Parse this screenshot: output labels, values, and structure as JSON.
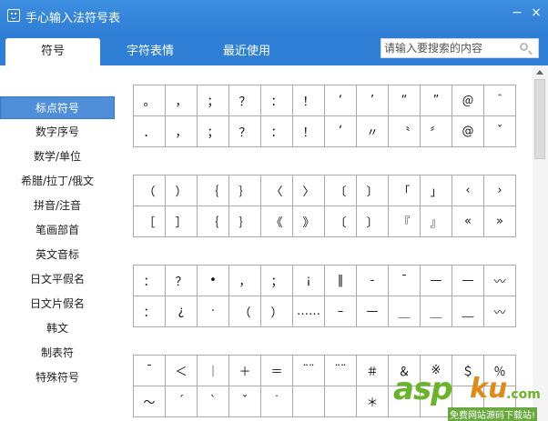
{
  "window": {
    "title": "手心输入法符号表",
    "minimize_label": "−",
    "close_label": "×"
  },
  "tabs": [
    {
      "label": "符号",
      "active": true
    },
    {
      "label": "字符表情",
      "active": false
    },
    {
      "label": "最近使用",
      "active": false
    }
  ],
  "search": {
    "placeholder": "请输入要搜索的内容"
  },
  "sidebar": {
    "items": [
      {
        "label": "标点符号",
        "active": true
      },
      {
        "label": "数字序号"
      },
      {
        "label": "数学/单位"
      },
      {
        "label": "希腊/拉丁/俄文"
      },
      {
        "label": "拼音/注音"
      },
      {
        "label": "笔画部首"
      },
      {
        "label": "英文音标"
      },
      {
        "label": "日文平假名"
      },
      {
        "label": "日文片假名"
      },
      {
        "label": "韩文"
      },
      {
        "label": "制表符"
      },
      {
        "label": "特殊符号"
      }
    ]
  },
  "symbol_groups": [
    [
      [
        "。",
        "，",
        "；",
        "？",
        "：",
        "！",
        "‘",
        "’",
        "“",
        "”",
        "＠",
        "＾"
      ],
      [
        "．",
        "，",
        "；",
        "？",
        "：",
        "！",
        "’",
        "〃",
        "〝",
        "〞",
        "@",
        "ˇ"
      ]
    ],
    [
      [
        "（",
        "）",
        "｛",
        "｝",
        "〈",
        "〉",
        "〔",
        "〕",
        "「",
        "」",
        "‹",
        "›"
      ],
      [
        "［",
        "］",
        "｛",
        "｝",
        "《",
        "》",
        "〔",
        "〕",
        "『",
        "』",
        "«",
        "»"
      ]
    ],
    [
      [
        "：",
        "？",
        "•",
        "，",
        "；",
        "¡",
        "‖",
        "-",
        "¯",
        "—",
        "—",
        "〰"
      ],
      [
        "：",
        "¿",
        "·",
        "（",
        "）",
        "……",
        "–",
        "—",
        "＿",
        "＿",
        "﹏",
        "〰"
      ]
    ],
    [
      [
        "ˉ",
        "＜",
        "｜",
        "＋",
        "＝",
        "¨¨",
        "¨¨",
        "＃",
        "＆",
        "※",
        "＄",
        "％"
      ],
      [
        "～",
        "ˊ",
        "ˋ",
        "ˇ",
        "˙",
        "",
        "",
        "＊",
        "",
        "",
        "",
        ""
      ]
    ]
  ],
  "watermark": {
    "part1": "asp",
    "part2": "ku",
    "part3": ".com",
    "subtitle": "免费网站源码下载站!"
  }
}
